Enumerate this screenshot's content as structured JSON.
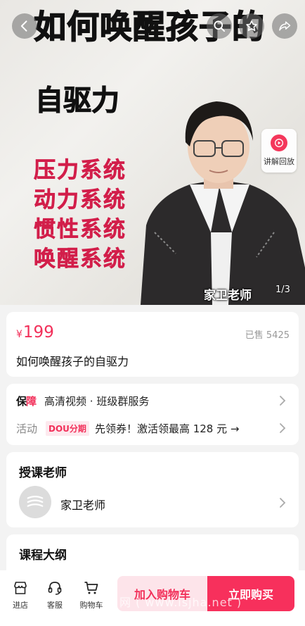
{
  "hero": {
    "title": "如何唤醒孩子的",
    "subtitle": "自驱力",
    "systems": [
      "压力系统",
      "动力系统",
      "惯性系统",
      "唤醒系统"
    ],
    "teacher_tag": "家卫老师",
    "page_indicator": "1/3",
    "replay_label": "讲解回放"
  },
  "product": {
    "currency": "¥",
    "price": "199",
    "sold": "已售 5425",
    "title": "如何唤醒孩子的自驱力"
  },
  "service": {
    "guarantee_a": "保",
    "guarantee_b": "障",
    "guarantee_text": "高清视频 · 班级群服务",
    "activity_label": "活动",
    "dou_tag": "DOU分期",
    "activity_text": "先领券！激活领最高 128 元 →"
  },
  "teacher": {
    "section_title": "授课老师",
    "name": "家卫老师"
  },
  "outline": {
    "section_title": "课程大纲"
  },
  "bottom": {
    "store": "进店",
    "service": "客服",
    "cart": "购物车",
    "add_to_cart": "加入购物车",
    "buy_now": "立即购买",
    "watermark": "网 ( www.isjha.net )"
  },
  "colors": {
    "accent": "#f2305a",
    "system_text": "#d21e4a"
  }
}
